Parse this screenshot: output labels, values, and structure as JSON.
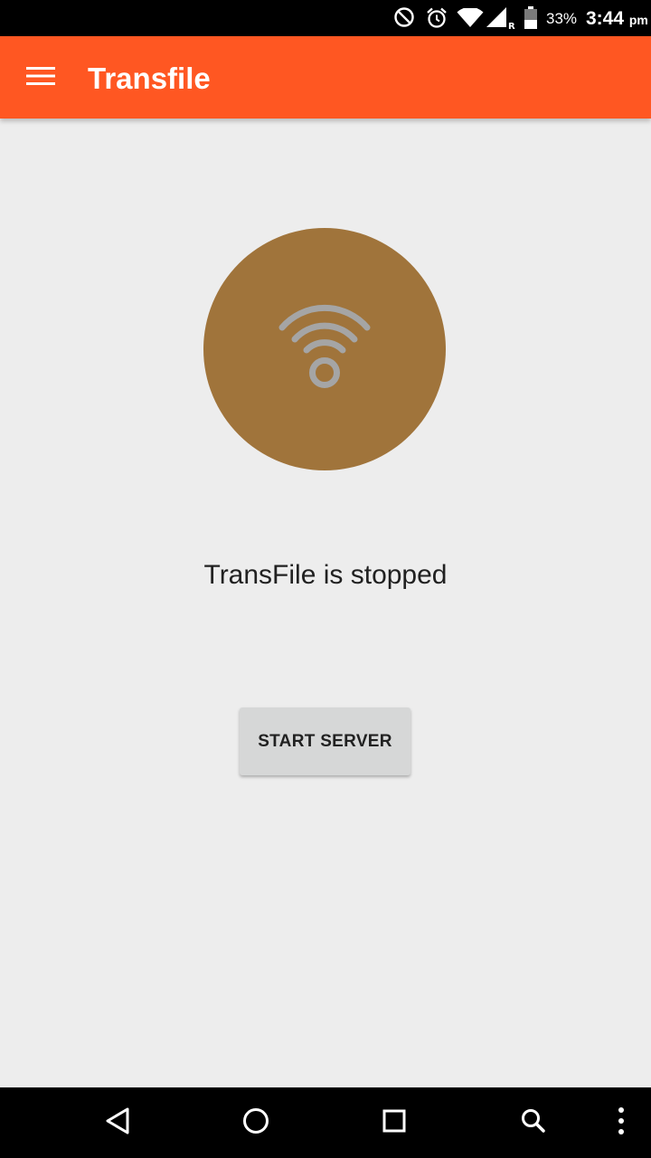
{
  "status_bar": {
    "battery_percent": "33%",
    "time": "3:44",
    "ampm": "pm",
    "icons": [
      "do-not-disturb-icon",
      "alarm-icon",
      "wifi-icon",
      "signal-icon",
      "battery-icon"
    ]
  },
  "app_bar": {
    "title": "Transfile",
    "menu_icon": "hamburger-menu-icon"
  },
  "main": {
    "status_icon": "wifi-signal-icon",
    "status_text": "TransFile is stopped",
    "start_button_label": "START SERVER"
  },
  "nav_bar": {
    "buttons": [
      "back-icon",
      "home-icon",
      "recents-icon",
      "search-icon",
      "more-options-icon"
    ]
  },
  "colors": {
    "app_bar": "#ff5722",
    "background": "#ededed",
    "status_circle": "#a0743b",
    "wifi_glyph": "#a5a5a5",
    "button": "#d6d7d7"
  }
}
